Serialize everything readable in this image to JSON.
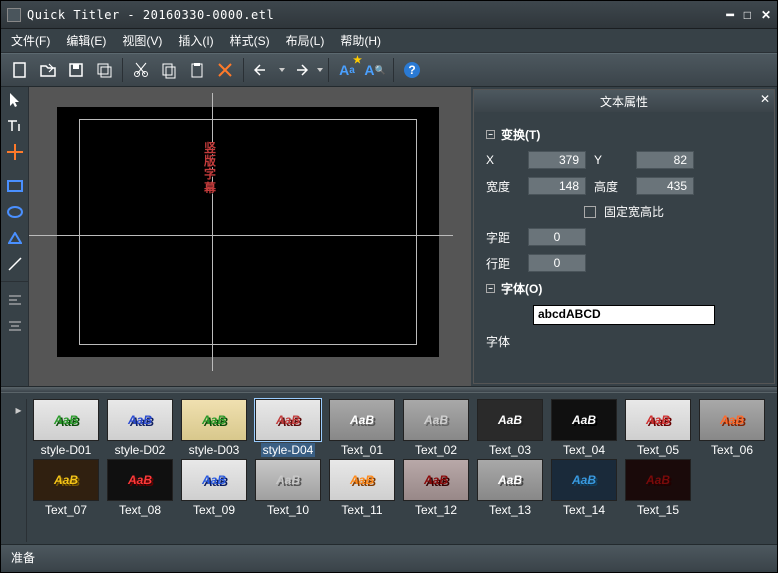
{
  "window": {
    "title": "Quick Titler - 20160330-0000.etl"
  },
  "menu": {
    "file": "文件(F)",
    "edit": "编辑(E)",
    "view": "视图(V)",
    "insert": "插入(I)",
    "style": "样式(S)",
    "layout": "布局(L)",
    "help": "帮助(H)"
  },
  "canvas": {
    "text": "竖版字幕"
  },
  "props": {
    "title": "文本属性",
    "transform_header": "变换(T)",
    "x_label": "X",
    "x_value": "379",
    "y_label": "Y",
    "y_value": "82",
    "width_label": "宽度",
    "width_value": "148",
    "height_label": "高度",
    "height_value": "435",
    "lock_aspect": "固定宽高比",
    "kerning_label": "字距",
    "kerning_value": "0",
    "leading_label": "行距",
    "leading_value": "0",
    "font_header": "字体(O)",
    "font_sample": "abcdABCD",
    "font_label": "字体"
  },
  "styles": [
    {
      "name": "style-D01",
      "fg": "#2a9a2a",
      "shadow": "#0a4a0a",
      "bg": "linear-gradient(#e8e8e8,#cfcfcf)"
    },
    {
      "name": "style-D02",
      "fg": "#2a4ad0",
      "shadow": "#102060",
      "bg": "linear-gradient(#e8e8e8,#cfcfcf)"
    },
    {
      "name": "style-D03",
      "fg": "#2a9a2a",
      "shadow": "#0a4a0a",
      "bg": "linear-gradient(#f0e0b0,#d8c88c)"
    },
    {
      "name": "style-D04",
      "fg": "#c23b3b",
      "shadow": "#5a0a0a",
      "bg": "linear-gradient(#e8e8e8,#cfcfcf)",
      "selected": true
    },
    {
      "name": "Text_01",
      "fg": "#ffffff",
      "shadow": "#555",
      "bg": "linear-gradient(#a8a8a8,#888)"
    },
    {
      "name": "Text_02",
      "fg": "#cfcfcf",
      "shadow": "#666",
      "bg": "linear-gradient(#a8a8a8,#888)"
    },
    {
      "name": "Text_03",
      "fg": "#ffffff",
      "shadow": "#222",
      "bg": "#2a2a2a"
    },
    {
      "name": "Text_04",
      "fg": "#ffffff",
      "shadow": "#000",
      "bg": "#101010"
    },
    {
      "name": "Text_05",
      "fg": "#d03030",
      "shadow": "#600",
      "bg": "linear-gradient(#e8e8e8,#cfcfcf)"
    },
    {
      "name": "Text_06",
      "fg": "#ff6a2a",
      "shadow": "#802000",
      "bg": "linear-gradient(#a8a8a8,#888)"
    },
    {
      "name": "Text_07",
      "fg": "#f5c518",
      "shadow": "#7a5a00",
      "bg": "#302010"
    },
    {
      "name": "Text_08",
      "fg": "#ff3a3a",
      "shadow": "#600",
      "bg": "#101010"
    },
    {
      "name": "Text_09",
      "fg": "#2a5ae0",
      "shadow": "#0a1a60",
      "bg": "linear-gradient(#e8e8e8,#cfcfcf)"
    },
    {
      "name": "Text_10",
      "fg": "#c8c8c8",
      "shadow": "#555",
      "bg": "linear-gradient(#c8c8c8,#a0a0a0)"
    },
    {
      "name": "Text_11",
      "fg": "#ff8a1a",
      "shadow": "#803a00",
      "bg": "linear-gradient(#e8e8e8,#cfcfcf)"
    },
    {
      "name": "Text_12",
      "fg": "#8a0a0a",
      "shadow": "#300",
      "bg": "linear-gradient(#b8a8a8,#988888)"
    },
    {
      "name": "Text_13",
      "fg": "#ffffff",
      "shadow": "#444",
      "bg": "linear-gradient(#a8a8a8,#888)"
    },
    {
      "name": "Text_14",
      "fg": "#3a9ae0",
      "shadow": "#104060",
      "bg": "#1a2a3a"
    },
    {
      "name": "Text_15",
      "fg": "#7a0a0a",
      "shadow": "#200",
      "bg": "#1a0a0a"
    }
  ],
  "status": {
    "ready": "准备"
  }
}
